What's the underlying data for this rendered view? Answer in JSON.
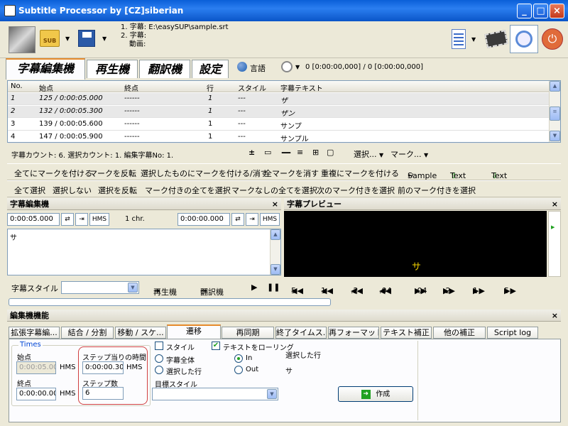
{
  "window": {
    "title": "Subtitle Processor by [CZ]siberian"
  },
  "toolbar": {
    "sub_label": "SUB",
    "file_info": [
      {
        "label": "1. 字幕:",
        "value": "E:\\easySUP\\sample.srt"
      },
      {
        "label": "2. 字幕:",
        "value": ""
      },
      {
        "label": "動画:",
        "value": ""
      }
    ]
  },
  "main_tabs": [
    {
      "label": "字幕編集機",
      "active": true
    },
    {
      "label": "再生機",
      "active": false
    },
    {
      "label": "翻訳機",
      "active": false
    },
    {
      "label": "設定",
      "active": false
    }
  ],
  "tab_extras": {
    "language_label": "言語",
    "time_counter": "0 [0:00:00,000] / 0 [0:00:00,000]"
  },
  "grid": {
    "columns": [
      "No.",
      "始点",
      "終点",
      "行",
      "スタイル",
      "字幕テキスト"
    ],
    "rows": [
      {
        "no": "1",
        "start": "125 / 0:00:05.000",
        "end": "------",
        "lines": "1",
        "style": "---",
        "text": "ザ"
      },
      {
        "no": "2",
        "start": "132 / 0:00:05.300",
        "end": "------",
        "lines": "1",
        "style": "---",
        "text": "ザン"
      },
      {
        "no": "3",
        "start": "139 / 0:00:05.600",
        "end": "------",
        "lines": "1",
        "style": "---",
        "text": "サンプ"
      },
      {
        "no": "4",
        "start": "147 / 0:00:05.900",
        "end": "------",
        "lines": "1",
        "style": "---",
        "text": "サンプル"
      }
    ]
  },
  "status": {
    "text": "字幕カウント: 6.   選択カウント: 1.   編集字幕No: 1.",
    "select_menu": "選択...",
    "mark_menu": "マーク..."
  },
  "mark_row": {
    "items": [
      "全てにマークを付ける",
      "マークを反転",
      "選択したものにマークを付ける/消す",
      "全マークを消す",
      "重複にマークを付ける"
    ],
    "sample": "Sample",
    "text_up": "Text",
    "text_down": "Text"
  },
  "select_row": {
    "items": [
      "全て選択",
      "選択しない",
      "選択を反転",
      "マーク付きの全てを選択",
      "マークなしの全てを選択",
      "次のマーク付きを選択",
      "前のマーク付きを選択"
    ]
  },
  "editor": {
    "title": "字幕編集機",
    "start_time": "0:00:05.000",
    "hms1": "HMS",
    "char_count": "1 chr.",
    "end_time": "0:00:00.000",
    "hms2": "HMS",
    "text": "サ",
    "style_label": "字幕スタイル"
  },
  "preview": {
    "title": "字幕プレビュー",
    "subtitle": "サ"
  },
  "playback": {
    "player_label": "再生機",
    "translator_label": "翻訳機",
    "steps": [
      "5",
      "1",
      ".2",
      ".04",
      ".04",
      ".2",
      "1",
      "5"
    ]
  },
  "functions": {
    "title": "編集機機能",
    "tabs": [
      {
        "label": "拡張字幕編...",
        "active": false
      },
      {
        "label": "結合 / 分割",
        "active": false
      },
      {
        "label": "移動 / スケ...",
        "active": false
      },
      {
        "label": "遷移",
        "active": true
      },
      {
        "label": "再同期",
        "active": false
      },
      {
        "label": "終了タイムス...",
        "active": false
      },
      {
        "label": "再フォーマット...",
        "active": false
      },
      {
        "label": "テキスト補正",
        "active": false
      },
      {
        "label": "他の補正",
        "active": false
      },
      {
        "label": "Script log",
        "active": false
      }
    ],
    "times_group": "Times",
    "start_label": "始点",
    "start_value": "0:00:05.00",
    "start_hms": "HMS",
    "end_label": "終点",
    "end_value": "0:00:00.00",
    "end_hms": "HMS",
    "step_time_label": "ステップ当りの時間",
    "step_time_value": "0:00:00.300",
    "step_time_hms": "HMS",
    "step_count_label": "ステップ数",
    "step_count_value": "6",
    "style_check": "スタイル",
    "all_subs": "字幕全体",
    "selected_line": "選択した行",
    "target_style": "目標スタイル",
    "roll_text": "テキストをローリング",
    "in_label": "In",
    "out_label": "Out",
    "selected_row_label": "選択した行",
    "selected_row_value": "サ",
    "create_button": "作成"
  },
  "colors": {
    "accent_orange": "#e68b2c",
    "highlight_red": "#d04040",
    "preview_text": "#f0d000"
  }
}
